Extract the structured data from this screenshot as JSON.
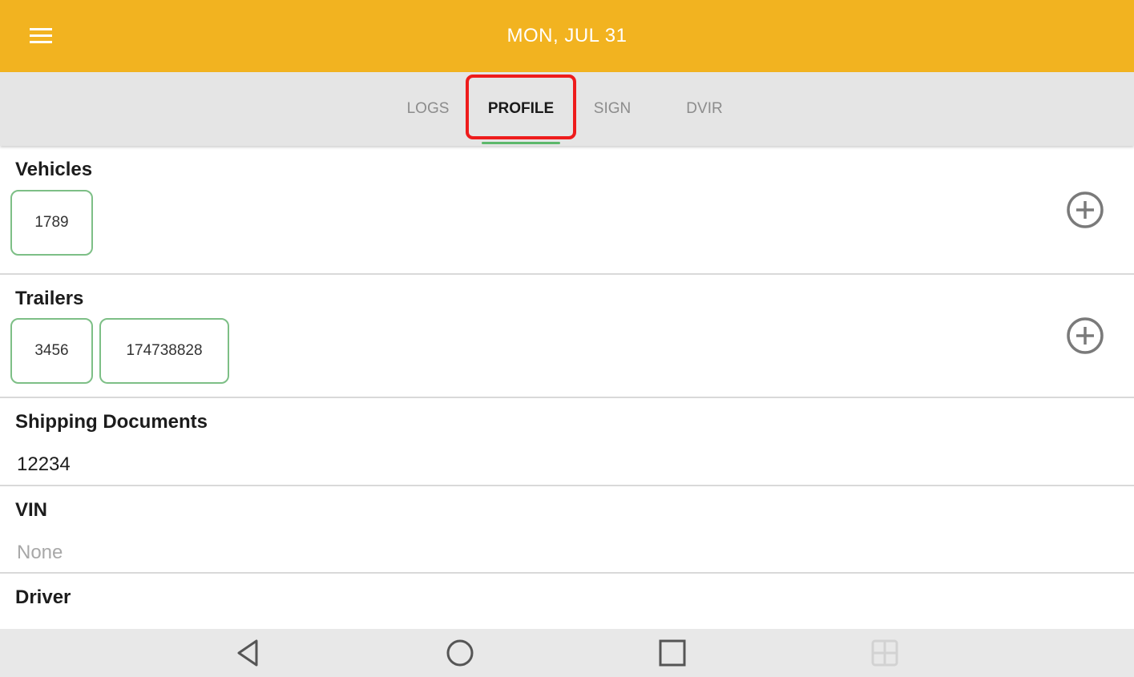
{
  "header": {
    "date": "MON, JUL 31"
  },
  "tabs": [
    {
      "label": "LOGS",
      "active": false
    },
    {
      "label": "PROFILE",
      "active": true
    },
    {
      "label": "SIGN",
      "active": false
    },
    {
      "label": "DVIR",
      "active": false
    }
  ],
  "profile": {
    "vehicles": {
      "title": "Vehicles",
      "items": [
        "1789"
      ]
    },
    "trailers": {
      "title": "Trailers",
      "items": [
        "3456",
        "174738828"
      ]
    },
    "shipping_documents": {
      "title": "Shipping Documents",
      "value": "12234"
    },
    "vin": {
      "title": "VIN",
      "value": "None"
    },
    "driver": {
      "title": "Driver"
    }
  },
  "icons": {
    "menu": "hamburger-menu-icon",
    "add": "plus-circle-icon",
    "nav_back": "triangle-back-icon",
    "nav_home": "circle-home-icon",
    "nav_recents": "square-recents-icon",
    "nav_extra": "grid-icon"
  },
  "colors": {
    "appbar": "#F2B320",
    "tab_indicator": "#5CB86B",
    "chip_border": "#7DBF86",
    "highlight": "#EE1C1C"
  }
}
